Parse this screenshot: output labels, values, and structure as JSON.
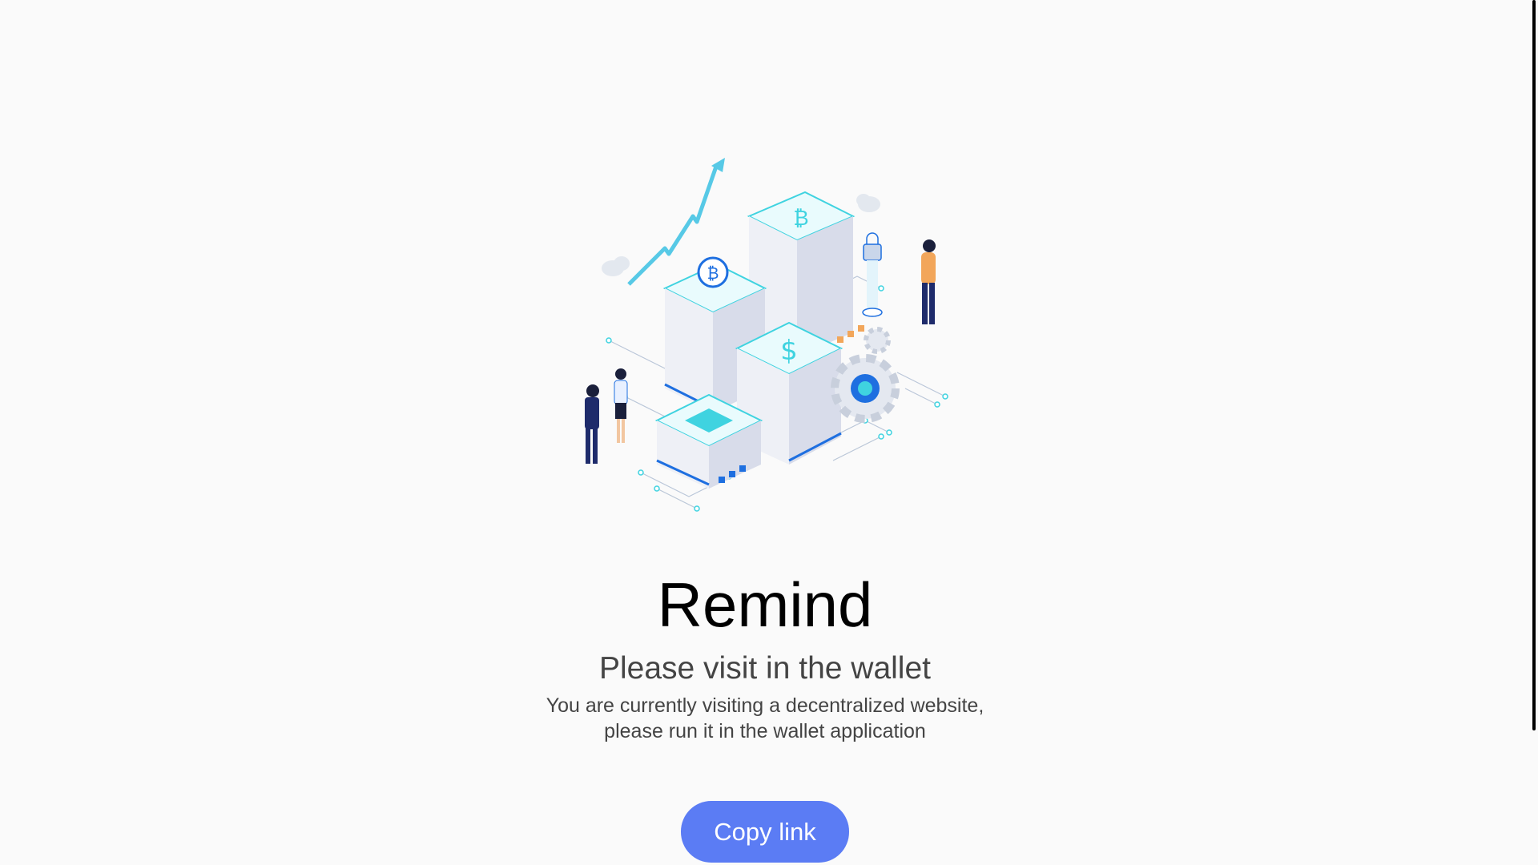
{
  "page": {
    "title": "Remind",
    "subtitle": "Please visit in the wallet",
    "description": "You are currently visiting a decentralized website, please run it in the wallet application",
    "copy_button_label": "Copy link"
  },
  "illustration": {
    "icon": "crypto-servers-isometric-illustration",
    "coin_symbol": "₿",
    "dollar_symbol": "$"
  },
  "colors": {
    "background": "#fafafa",
    "accent": "#5b7cf4",
    "cyan": "#3fd3e0",
    "blue": "#1e6fe0"
  }
}
